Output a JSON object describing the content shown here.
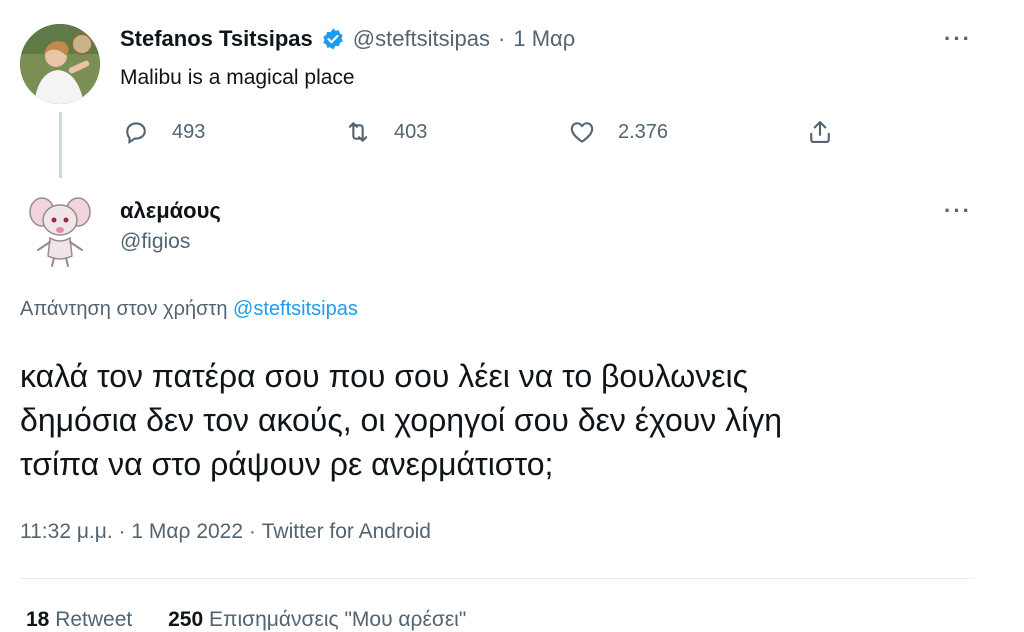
{
  "parent_tweet": {
    "author_name": "Stefanos Tsitsipas",
    "verified": true,
    "handle": "@steftsitsipas",
    "separator": "·",
    "date": "1 Μαρ",
    "text": "Malibu is a magical place",
    "reply_count": "493",
    "retweet_count": "403",
    "like_count": "2.376",
    "more_label": "···"
  },
  "reply_tweet": {
    "author_name": "αλεμάους",
    "handle": "@figios",
    "more_label": "···",
    "replying_to_prefix": "Απάντηση στον χρήστη",
    "replying_to_handle": "@steftsitsipas",
    "text_line1": "καλά τον πατέρα σου που σου λέει να το βουλωνεις",
    "text_line2": "δημόσια δεν τον ακούς, οι χορηγοί σου δεν έχουν λίγη",
    "text_line3": "τσίπα να στο ράψουν ρε ανερμάτιστο;",
    "time": "11:32 μ.μ.",
    "date": "1 Μαρ 2022",
    "source": "Twitter for Android",
    "dot": "·",
    "retweet_count": "18",
    "retweet_label": "Retweet",
    "like_count": "250",
    "like_label": "Επισημάνσεις \"Μου αρέσει\""
  },
  "colors": {
    "text": "#0f1419",
    "muted": "#536471",
    "link": "#1d9bf0",
    "verified": "#1d9bf0",
    "divider": "#e6ecf0"
  }
}
